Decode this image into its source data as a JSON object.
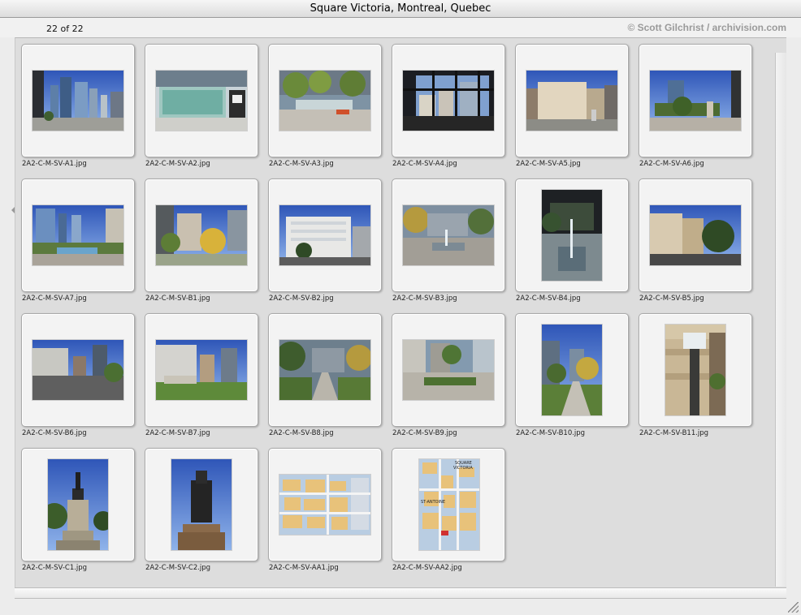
{
  "window": {
    "title": "Square Victoria, Montreal, Quebec"
  },
  "info": {
    "count": "22 of 22",
    "credit": "© Scott Gilchrist / archivision.com"
  },
  "thumbnails": [
    {
      "name": "2A2-C-M-SV-A1.jpg",
      "orientation": "land",
      "scene": "towers"
    },
    {
      "name": "2A2-C-M-SV-A2.jpg",
      "orientation": "land",
      "scene": "glass-pavilion"
    },
    {
      "name": "2A2-C-M-SV-A3.jpg",
      "orientation": "land",
      "scene": "plaza-trees"
    },
    {
      "name": "2A2-C-M-SV-A4.jpg",
      "orientation": "land",
      "scene": "window-view"
    },
    {
      "name": "2A2-C-M-SV-A5.jpg",
      "orientation": "land",
      "scene": "stone-building"
    },
    {
      "name": "2A2-C-M-SV-A6.jpg",
      "orientation": "land",
      "scene": "square-statue"
    },
    {
      "name": "2A2-C-M-SV-A7.jpg",
      "orientation": "land",
      "scene": "fountain-towers"
    },
    {
      "name": "2A2-C-M-SV-B1.jpg",
      "orientation": "land",
      "scene": "autumn-park"
    },
    {
      "name": "2A2-C-M-SV-B2.jpg",
      "orientation": "land",
      "scene": "white-building"
    },
    {
      "name": "2A2-C-M-SV-B3.jpg",
      "orientation": "land",
      "scene": "fountain-plaza"
    },
    {
      "name": "2A2-C-M-SV-B4.jpg",
      "orientation": "port",
      "scene": "fountain-dark"
    },
    {
      "name": "2A2-C-M-SV-B5.jpg",
      "orientation": "land",
      "scene": "historic-block"
    },
    {
      "name": "2A2-C-M-SV-B6.jpg",
      "orientation": "land",
      "scene": "street-plaza"
    },
    {
      "name": "2A2-C-M-SV-B7.jpg",
      "orientation": "land",
      "scene": "lawn-towers"
    },
    {
      "name": "2A2-C-M-SV-B8.jpg",
      "orientation": "land",
      "scene": "walkway"
    },
    {
      "name": "2A2-C-M-SV-B9.jpg",
      "orientation": "land",
      "scene": "square-paving"
    },
    {
      "name": "2A2-C-M-SV-B10.jpg",
      "orientation": "port",
      "scene": "path-portrait"
    },
    {
      "name": "2A2-C-M-SV-B11.jpg",
      "orientation": "port",
      "scene": "lamp-post"
    },
    {
      "name": "2A2-C-M-SV-C1.jpg",
      "orientation": "port",
      "scene": "statue-plinth"
    },
    {
      "name": "2A2-C-M-SV-C2.jpg",
      "orientation": "port",
      "scene": "statue-close"
    },
    {
      "name": "2A2-C-M-SV-AA1.jpg",
      "orientation": "land",
      "scene": "map"
    },
    {
      "name": "2A2-C-M-SV-AA2.jpg",
      "orientation": "port-square",
      "scene": "map-square",
      "map_labels": [
        "SQUARE",
        "VICTORIA",
        "ST-ANTOINE"
      ]
    }
  ],
  "colors": {
    "window_bg": "#ececec",
    "pane_bg": "#dddddd",
    "slide_bg": "#f3f3f3",
    "credit_text": "#9a9a9a"
  }
}
